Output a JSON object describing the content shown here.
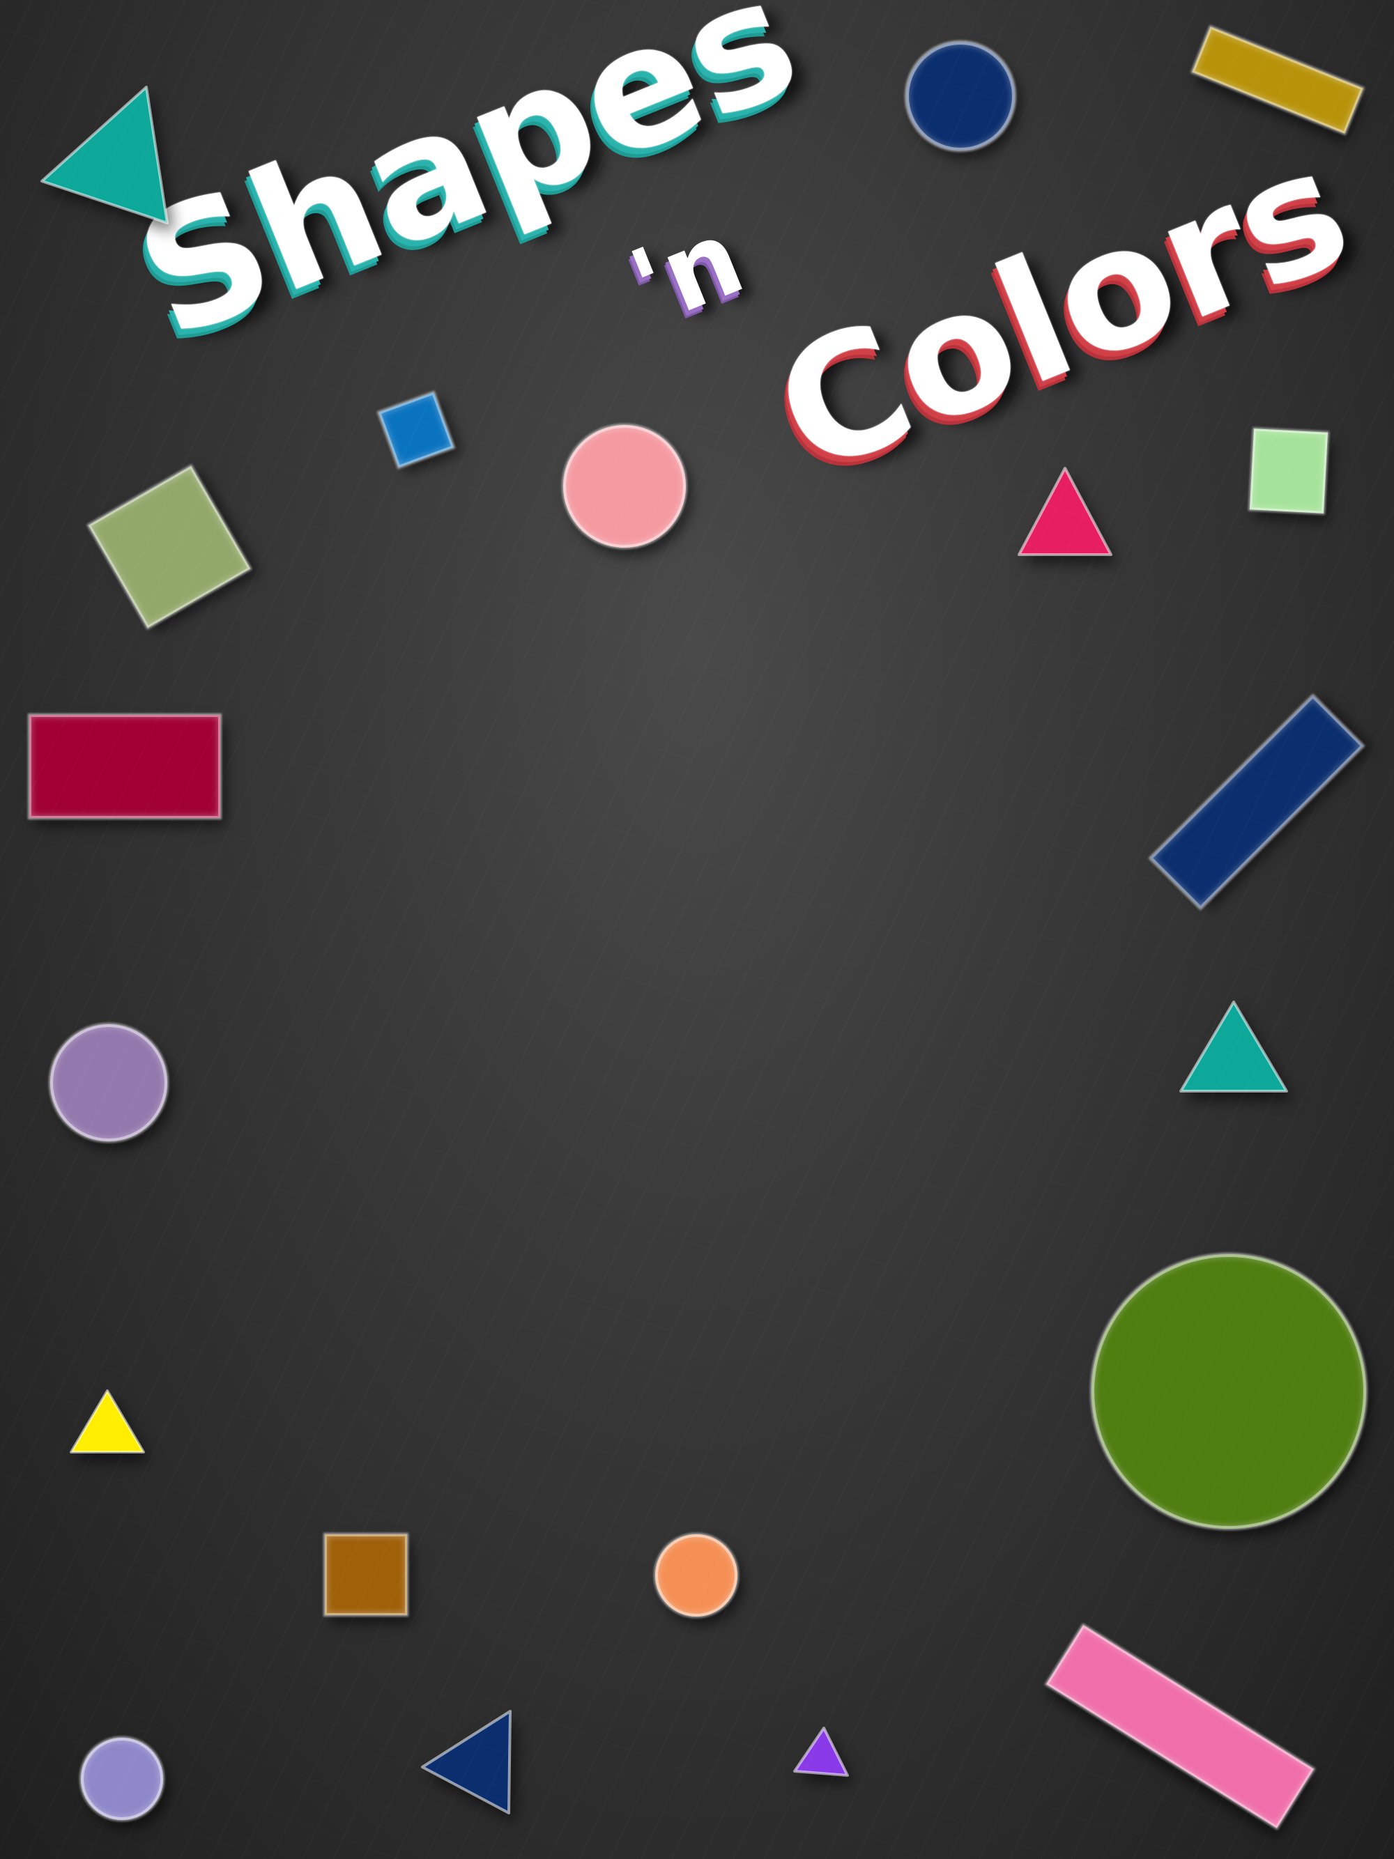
{
  "title": {
    "word1": "Shapes",
    "word2": "'n",
    "word3": "Colors"
  },
  "colors": {
    "background": "#333333",
    "shapes_word": "#2ab3ac",
    "n_word": "#9a70c4",
    "colors_word": "#d13f47",
    "teal": "#0ea89b",
    "navy": "#0b2e6e",
    "mustard": "#b8930a",
    "crimson": "#a10035",
    "sage": "#92a86a",
    "blue": "#0a73c0",
    "pink_circle": "#f59aa1",
    "magenta": "#e81e63",
    "mint": "#a6e39a",
    "lavender": "#9378ad",
    "olive_green": "#4e7d10",
    "yellow": "#ffee00",
    "brown": "#a0600a",
    "orange": "#f59055",
    "periwinkle": "#8e88c9",
    "violet": "#8a39e8",
    "hot_pink": "#f06ea9"
  }
}
